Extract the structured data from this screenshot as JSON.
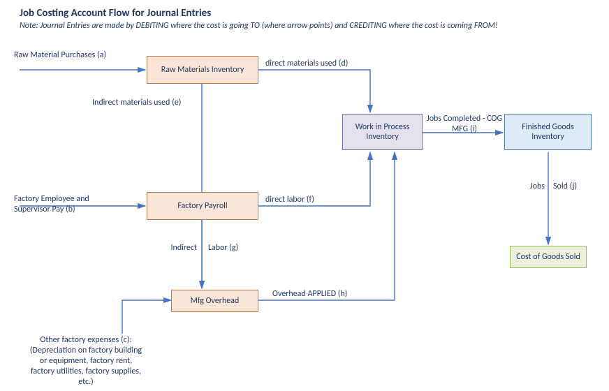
{
  "header": {
    "title": "Job Costing Account Flow for Journal Entries",
    "note": "Note:  Journal Entries are made by DEBITING where the cost is going TO (where arrow points) and CREDITING where the cost is coming FROM!"
  },
  "boxes": {
    "raw_materials": "Raw Materials Inventory",
    "factory_payroll": "Factory Payroll",
    "mfg_overhead": "Mfg Overhead",
    "wip": "Work in Process Inventory",
    "finished_goods": "Finished Goods Inventory",
    "cogs": "Cost of Goods Sold"
  },
  "labels": {
    "a": "Raw Material Purchases (a)",
    "b_line1": "Factory Employee and",
    "b_line2": "Supervisor Pay (b)",
    "c_line1": "Other factory expenses (c):",
    "c_line2": "(Depreciation on factory building",
    "c_line3": "or equipment, factory rent,",
    "c_line4": "factory utilities, factory supplies,",
    "c_line5": "etc.)",
    "d": "direct materials used (d)",
    "e": "Indirect materials used (e)",
    "f": "direct labor (f)",
    "g_left": "Indirect",
    "g_right": "Labor (g)",
    "h": "Overhead APPLIED (h)",
    "i_line1": "Jobs Completed - COG",
    "i_line2": "MFG (i)",
    "j_left": "Jobs",
    "j_right": "Sold (j)"
  }
}
